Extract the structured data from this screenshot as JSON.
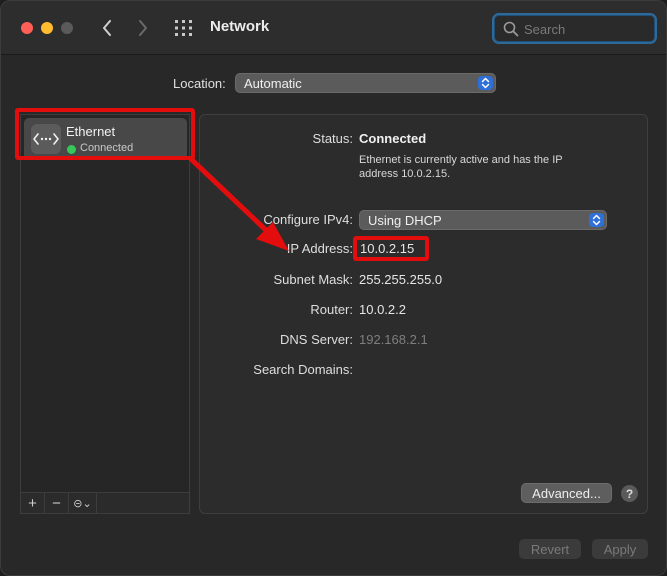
{
  "window": {
    "title": "Network",
    "search_placeholder": "Search"
  },
  "location": {
    "label": "Location:",
    "value": "Automatic"
  },
  "sidebar": {
    "items": [
      {
        "name": "Ethernet",
        "status": "Connected",
        "status_color": "#35c759"
      }
    ],
    "toolbar": {
      "add": "+",
      "remove": "−",
      "action": "⊝⌄"
    }
  },
  "details": {
    "status_label": "Status:",
    "status_value": "Connected",
    "status_description": "Ethernet is currently active and has the IP address 10.0.2.15.",
    "configure_label": "Configure IPv4:",
    "configure_value": "Using DHCP",
    "ip_label": "IP Address:",
    "ip_value": "10.0.2.15",
    "subnet_label": "Subnet Mask:",
    "subnet_value": "255.255.255.0",
    "router_label": "Router:",
    "router_value": "10.0.2.2",
    "dns_label": "DNS Server:",
    "dns_value": "192.168.2.1",
    "search_domains_label": "Search Domains:"
  },
  "buttons": {
    "advanced": "Advanced...",
    "help": "?",
    "revert": "Revert",
    "apply": "Apply"
  },
  "colors": {
    "accent": "#2f6fd8",
    "annotation": "#e30d0d",
    "connected": "#35c759"
  }
}
